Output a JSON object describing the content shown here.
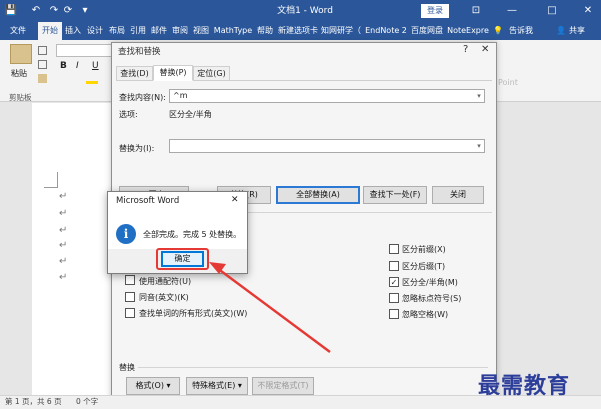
{
  "titlebar": {
    "title": "文档1 - Word",
    "login_label": "登录",
    "save_icon": "💾",
    "undo_icon": "↶",
    "redo_icon": "↷",
    "refresh_icon": "⟳",
    "customize_icon": "▾",
    "ribbon_display_icon": "⊡",
    "minimize_icon": "—",
    "maximize_icon": "□",
    "close_icon": "✕"
  },
  "ribbon_tabs": [
    {
      "label": "文件"
    },
    {
      "label": "开始"
    },
    {
      "label": "插入"
    },
    {
      "label": "设计"
    },
    {
      "label": "布局"
    },
    {
      "label": "引用"
    },
    {
      "label": "邮件"
    },
    {
      "label": "审阅"
    },
    {
      "label": "视图"
    },
    {
      "label": "MathType"
    },
    {
      "label": "帮助"
    },
    {
      "label": "新建选项卡"
    },
    {
      "label": "知网研学（"
    },
    {
      "label": "EndNote 2"
    },
    {
      "label": "百度网盘"
    },
    {
      "label": "NoteExpre"
    },
    {
      "label": "告诉我"
    },
    {
      "label": "共享"
    }
  ],
  "ribbon": {
    "paste_label": "粘贴",
    "clipboard_label": "剪贴板",
    "bold_label": "B",
    "italic_label": "I",
    "underline_label": "U",
    "point_label": "Point"
  },
  "find_replace": {
    "title": "查找和替换",
    "help_icon": "?",
    "close_icon": "✕",
    "tabs": [
      {
        "label": "查找(D)"
      },
      {
        "label": "替换(P)"
      },
      {
        "label": "定位(G)"
      }
    ],
    "find_label": "查找内容(N):",
    "find_value": "^m",
    "options_label": "选项:",
    "options_value": "区分全/半角",
    "replace_label": "替换为(I):",
    "replace_value": "",
    "buttons": {
      "less": "<< 更少(L)",
      "replace": "替换(R)",
      "replace_all": "全部替换(A)",
      "find_next": "查找下一处(F)",
      "close": "关闭"
    },
    "checkboxes_left": [
      {
        "label": "使用通配符(U)",
        "checked": false
      },
      {
        "label": "同音(英文)(K)",
        "checked": false
      },
      {
        "label": "查找单词的所有形式(英文)(W)",
        "checked": false
      }
    ],
    "checkboxes_right": [
      {
        "label": "区分前缀(X)",
        "checked": false
      },
      {
        "label": "区分后缀(T)",
        "checked": false
      },
      {
        "label": "区分全/半角(M)",
        "checked": true
      },
      {
        "label": "忽略标点符号(S)",
        "checked": false
      },
      {
        "label": "忽略空格(W)",
        "checked": false
      }
    ],
    "replace_section_label": "替换",
    "format_label": "格式(O) ▾",
    "special_label": "特殊格式(E) ▾",
    "no_format_label": "不限定格式(T)"
  },
  "message_box": {
    "title": "Microsoft Word",
    "close_icon": "✕",
    "info_glyph": "i",
    "message": "全部完成。完成 5 处替换。",
    "ok_label": "确定"
  },
  "statusbar": {
    "page": "第 1 页，共 6 页",
    "words": "0 个字"
  },
  "document": {
    "para_marks": [
      "↵",
      "↵",
      "↵",
      "↵",
      "↵",
      "↵"
    ]
  },
  "watermark": "最需教育",
  "colors": {
    "word_blue": "#2b579a",
    "arrow_red": "#e53935",
    "info_blue": "#1f6fc5"
  }
}
